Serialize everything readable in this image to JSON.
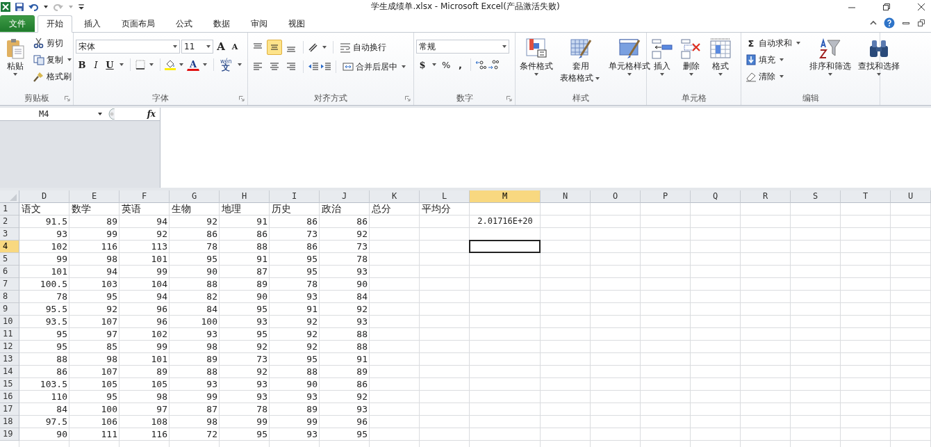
{
  "window": {
    "title": "学生成绩单.xlsx  -  Microsoft Excel(产品激活失败)"
  },
  "tabs": [
    {
      "label": "文件",
      "kind": "file",
      "selected": false
    },
    {
      "label": "开始",
      "kind": "tab",
      "selected": true
    },
    {
      "label": "插入",
      "kind": "tab",
      "selected": false
    },
    {
      "label": "页面布局",
      "kind": "tab",
      "selected": false
    },
    {
      "label": "公式",
      "kind": "tab",
      "selected": false
    },
    {
      "label": "数据",
      "kind": "tab",
      "selected": false
    },
    {
      "label": "审阅",
      "kind": "tab",
      "selected": false
    },
    {
      "label": "视图",
      "kind": "tab",
      "selected": false
    }
  ],
  "ribbon": {
    "clipboard": {
      "paste": "粘贴",
      "cut": "剪切",
      "copy": "复制",
      "painter": "格式刷",
      "label": "剪贴板"
    },
    "font": {
      "name": "宋体",
      "size": "11",
      "grow": "A",
      "shrink": "A",
      "bold": "B",
      "italic": "I",
      "underline": "U",
      "color_letter": "A",
      "phonetic_top": "wén",
      "phonetic": "文",
      "label": "字体"
    },
    "alignment": {
      "wrap": "自动换行",
      "merge": "合并后居中",
      "label": "对齐方式",
      "middle_selected": true
    },
    "number": {
      "format": "常规",
      "currency": "$",
      "percent": "%",
      "comma": ",",
      "label": "数字"
    },
    "styles": {
      "conditional": "条件格式",
      "table_1": "套用",
      "table_2": "表格格式",
      "cell": "单元格样式",
      "label": "样式"
    },
    "cells": {
      "insert": "插入",
      "delete": "删除",
      "format": "格式",
      "label": "单元格"
    },
    "editing": {
      "sum_sign": "Σ",
      "autosum": "自动求和",
      "fill": "填充",
      "clear": "清除",
      "sort": "排序和筛选",
      "find": "查找和选择",
      "label": "编辑"
    }
  },
  "formula_bar": {
    "name_box": "M4",
    "function_label": "fx"
  },
  "sheet": {
    "columns": [
      {
        "label": "D",
        "selected": false
      },
      {
        "label": "E",
        "selected": false
      },
      {
        "label": "F",
        "selected": false
      },
      {
        "label": "G",
        "selected": false
      },
      {
        "label": "H",
        "selected": false
      },
      {
        "label": "I",
        "selected": false
      },
      {
        "label": "J",
        "selected": false
      },
      {
        "label": "K",
        "selected": false
      },
      {
        "label": "L",
        "selected": false
      },
      {
        "label": "M",
        "selected": true
      },
      {
        "label": "N",
        "selected": false
      },
      {
        "label": "O",
        "selected": false
      },
      {
        "label": "P",
        "selected": false
      },
      {
        "label": "Q",
        "selected": false
      },
      {
        "label": "R",
        "selected": false
      },
      {
        "label": "S",
        "selected": false
      },
      {
        "label": "T",
        "selected": false
      },
      {
        "label": "U",
        "selected": false
      }
    ],
    "rows": [
      {
        "number": "1",
        "kind": "text",
        "selected": false,
        "cells": [
          "语文",
          "数学",
          "英语",
          "生物",
          "地理",
          "历史",
          "政治",
          "总分",
          "平均分"
        ]
      },
      {
        "number": "2",
        "kind": "number",
        "selected": false,
        "cells": [
          "91.5",
          "89",
          "94",
          "92",
          "91",
          "86",
          "86"
        ],
        "column_m": "2.01716E+20"
      },
      {
        "number": "3",
        "kind": "number",
        "selected": false,
        "cells": [
          "93",
          "99",
          "92",
          "86",
          "86",
          "73",
          "92"
        ]
      },
      {
        "number": "4",
        "kind": "number",
        "selected": true,
        "cells": [
          "102",
          "116",
          "113",
          "78",
          "88",
          "86",
          "73"
        ]
      },
      {
        "number": "5",
        "kind": "number",
        "selected": false,
        "cells": [
          "99",
          "98",
          "101",
          "95",
          "91",
          "95",
          "78"
        ]
      },
      {
        "number": "6",
        "kind": "number",
        "selected": false,
        "cells": [
          "101",
          "94",
          "99",
          "90",
          "87",
          "95",
          "93"
        ]
      },
      {
        "number": "7",
        "kind": "number",
        "selected": false,
        "cells": [
          "100.5",
          "103",
          "104",
          "88",
          "89",
          "78",
          "90"
        ]
      },
      {
        "number": "8",
        "kind": "number",
        "selected": false,
        "cells": [
          "78",
          "95",
          "94",
          "82",
          "90",
          "93",
          "84"
        ]
      },
      {
        "number": "9",
        "kind": "number",
        "selected": false,
        "cells": [
          "95.5",
          "92",
          "96",
          "84",
          "95",
          "91",
          "92"
        ]
      },
      {
        "number": "10",
        "kind": "number",
        "selected": false,
        "cells": [
          "93.5",
          "107",
          "96",
          "100",
          "93",
          "92",
          "93"
        ]
      },
      {
        "number": "11",
        "kind": "number",
        "selected": false,
        "cells": [
          "95",
          "97",
          "102",
          "93",
          "95",
          "92",
          "88"
        ]
      },
      {
        "number": "12",
        "kind": "number",
        "selected": false,
        "cells": [
          "95",
          "85",
          "99",
          "98",
          "92",
          "92",
          "88"
        ]
      },
      {
        "number": "13",
        "kind": "number",
        "selected": false,
        "cells": [
          "88",
          "98",
          "101",
          "89",
          "73",
          "95",
          "91"
        ]
      },
      {
        "number": "14",
        "kind": "number",
        "selected": false,
        "cells": [
          "86",
          "107",
          "89",
          "88",
          "92",
          "88",
          "89"
        ]
      },
      {
        "number": "15",
        "kind": "number",
        "selected": false,
        "cells": [
          "103.5",
          "105",
          "105",
          "93",
          "93",
          "90",
          "86"
        ]
      },
      {
        "number": "16",
        "kind": "number",
        "selected": false,
        "cells": [
          "110",
          "95",
          "98",
          "99",
          "93",
          "93",
          "92"
        ]
      },
      {
        "number": "17",
        "kind": "number",
        "selected": false,
        "cells": [
          "84",
          "100",
          "97",
          "87",
          "78",
          "89",
          "93"
        ]
      },
      {
        "number": "18",
        "kind": "number",
        "selected": false,
        "cells": [
          "97.5",
          "106",
          "108",
          "98",
          "99",
          "99",
          "96"
        ]
      },
      {
        "number": "19",
        "kind": "number",
        "selected": false,
        "cells": [
          "90",
          "111",
          "116",
          "72",
          "95",
          "93",
          "95"
        ]
      }
    ]
  }
}
